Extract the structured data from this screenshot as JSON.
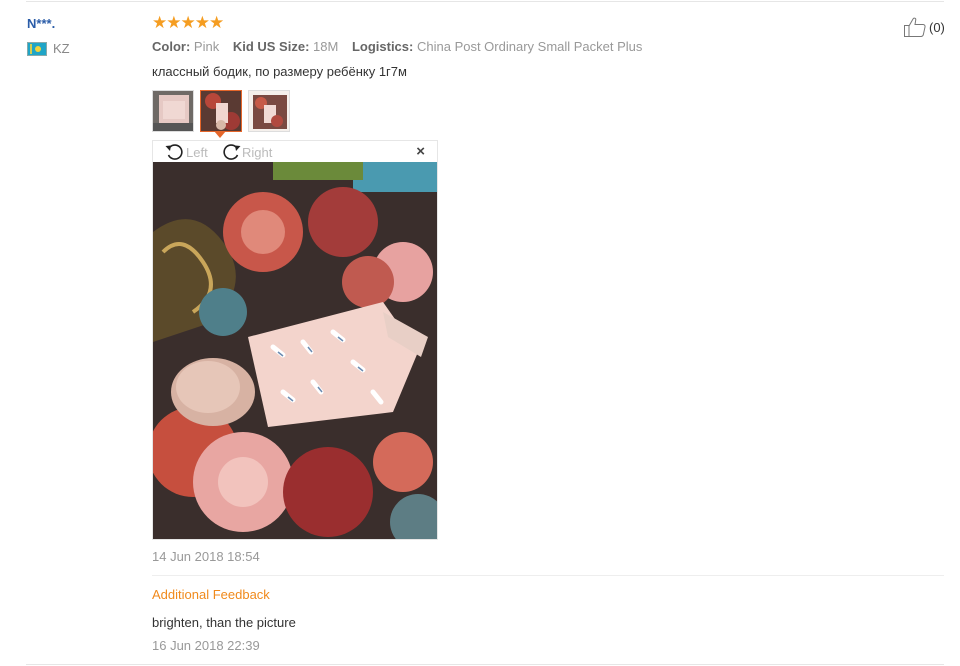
{
  "review": {
    "user_name": "N***.",
    "country_code": "KZ",
    "helpful_count": "(0)",
    "rating": 5,
    "attributes": [
      {
        "key": "Color:",
        "value": "Pink"
      },
      {
        "key": "Kid US Size:",
        "value": "18M"
      },
      {
        "key": "Logistics:",
        "value": "China Post Ordinary Small Packet Plus"
      }
    ],
    "text": "классный бодик, по размеру ребёнку 1г7м",
    "viewer": {
      "rotate_left_label": "Left",
      "rotate_right_label": "Right",
      "close_label": "×"
    },
    "date": "14 Jun 2018 18:54",
    "additional": {
      "title": "Additional Feedback",
      "text": "brighten, than the picture",
      "date": "16 Jun 2018 22:39"
    }
  },
  "colors": {
    "star": "#f59d21",
    "user_link": "#2a5ca8",
    "accent": "#e5662a",
    "additional_title": "#f08a1c"
  },
  "icons": [
    "flag-kz-icon",
    "thumbs-up-icon",
    "star-icon",
    "rotate-left-icon",
    "rotate-right-icon",
    "close-icon"
  ]
}
